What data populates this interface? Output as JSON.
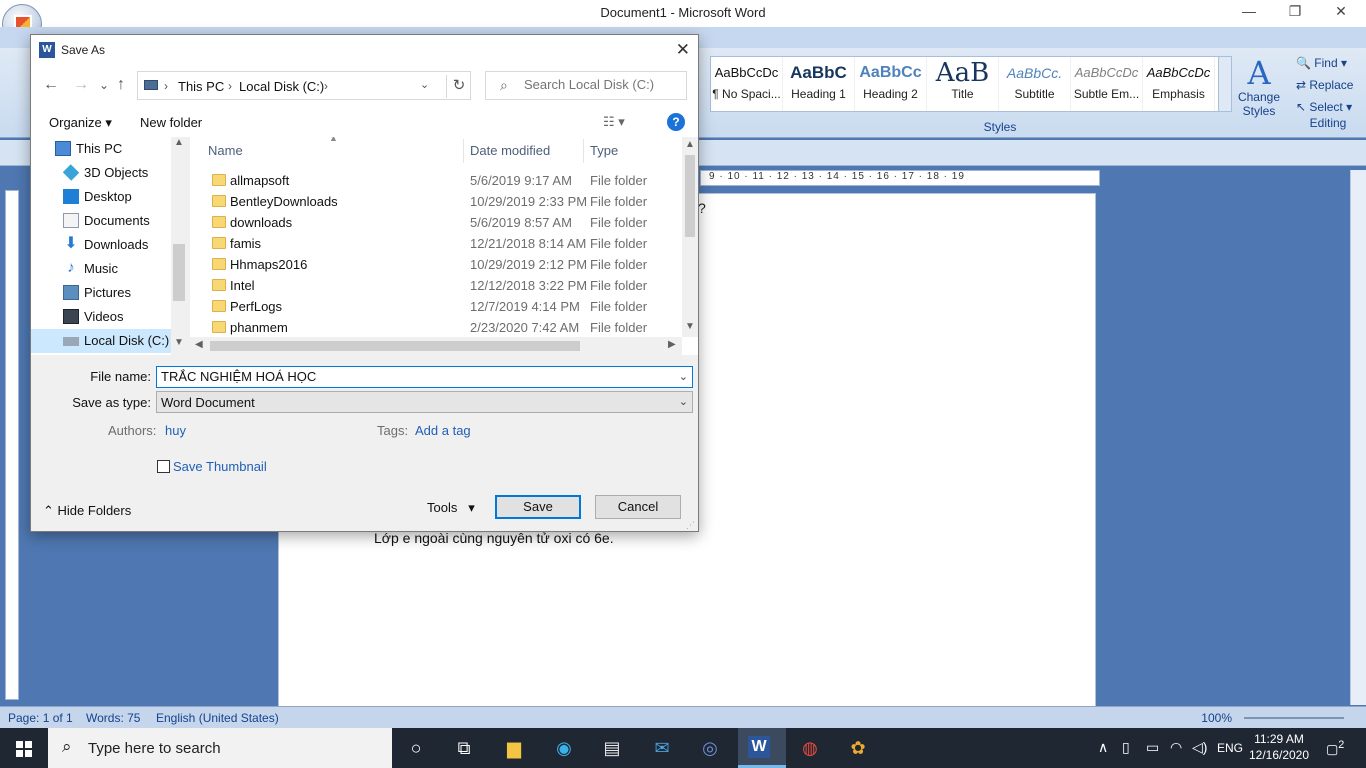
{
  "word": {
    "title": "Document1 - Microsoft Word",
    "styles_gallery": [
      {
        "preview": "AaBbCcDc",
        "name": "¶ No Spaci..."
      },
      {
        "preview": "AaBbC",
        "name": "Heading 1"
      },
      {
        "preview": "AaBbCc",
        "name": "Heading 2"
      },
      {
        "preview": "AaB",
        "name": "Title"
      },
      {
        "preview": "AaBbCc.",
        "name": "Subtitle"
      },
      {
        "preview": "AaBbCcDc",
        "name": "Subtle Em..."
      },
      {
        "preview": "AaBbCcDc",
        "name": "Emphasis"
      }
    ],
    "change_styles": "Change Styles",
    "styles_group": "Styles",
    "editing": {
      "find": "Find",
      "replace": "Replace",
      "select": "Select",
      "group": "Editing"
    },
    "ruler_text": "9 · 10 · 11 · 12 · 13 · 14 · 15 · 16 · 17 · 18 · 19",
    "doc_fragment": "?",
    "doc_line": "Lớp e ngoài cùng nguyên tử oxi có 6e.",
    "status": {
      "page": "Page: 1 of 1",
      "words": "Words: 75",
      "language": "English (United States)",
      "zoom": "100%"
    }
  },
  "dialog": {
    "title": "Save As",
    "breadcrumb": [
      "This PC",
      "Local Disk (C:)"
    ],
    "search_placeholder": "Search Local Disk (C:)",
    "organize": "Organize",
    "new_folder": "New folder",
    "nav_items": [
      {
        "label": "This PC",
        "icon": "computer-icon"
      },
      {
        "label": "3D Objects",
        "icon": "cube-icon"
      },
      {
        "label": "Desktop",
        "icon": "desktop-icon"
      },
      {
        "label": "Documents",
        "icon": "documents-icon"
      },
      {
        "label": "Downloads",
        "icon": "download-arrow-icon"
      },
      {
        "label": "Music",
        "icon": "music-note-icon"
      },
      {
        "label": "Pictures",
        "icon": "pictures-icon"
      },
      {
        "label": "Videos",
        "icon": "film-icon"
      },
      {
        "label": "Local Disk (C:)",
        "icon": "drive-icon"
      }
    ],
    "columns": {
      "name": "Name",
      "date": "Date modified",
      "type": "Type"
    },
    "files": [
      {
        "name": "allmapsoft",
        "date": "5/6/2019 9:17 AM",
        "type": "File folder"
      },
      {
        "name": "BentleyDownloads",
        "date": "10/29/2019 2:33 PM",
        "type": "File folder"
      },
      {
        "name": "downloads",
        "date": "5/6/2019 8:57 AM",
        "type": "File folder"
      },
      {
        "name": "famis",
        "date": "12/21/2018 8:14 AM",
        "type": "File folder"
      },
      {
        "name": "Hhmaps2016",
        "date": "10/29/2019 2:12 PM",
        "type": "File folder"
      },
      {
        "name": "Intel",
        "date": "12/12/2018 3:22 PM",
        "type": "File folder"
      },
      {
        "name": "PerfLogs",
        "date": "12/7/2019 4:14 PM",
        "type": "File folder"
      },
      {
        "name": "phanmem",
        "date": "2/23/2020 7:42 AM",
        "type": "File folder"
      }
    ],
    "file_name_label": "File name:",
    "file_name_value": "TRẮC NGHIỆM HOÁ HỌC",
    "save_as_type_label": "Save as type:",
    "save_as_type_value": "Word Document",
    "authors_label": "Authors:",
    "authors_value": "huy",
    "tags_label": "Tags:",
    "tags_value": "Add a tag",
    "save_thumbnail": "Save Thumbnail",
    "hide_folders": "Hide Folders",
    "tools": "Tools",
    "save": "Save",
    "cancel": "Cancel"
  },
  "taskbar": {
    "search_placeholder": "Type here to search",
    "language": "ENG",
    "time": "11:29 AM",
    "date": "12/16/2020",
    "notification_count": "2"
  }
}
